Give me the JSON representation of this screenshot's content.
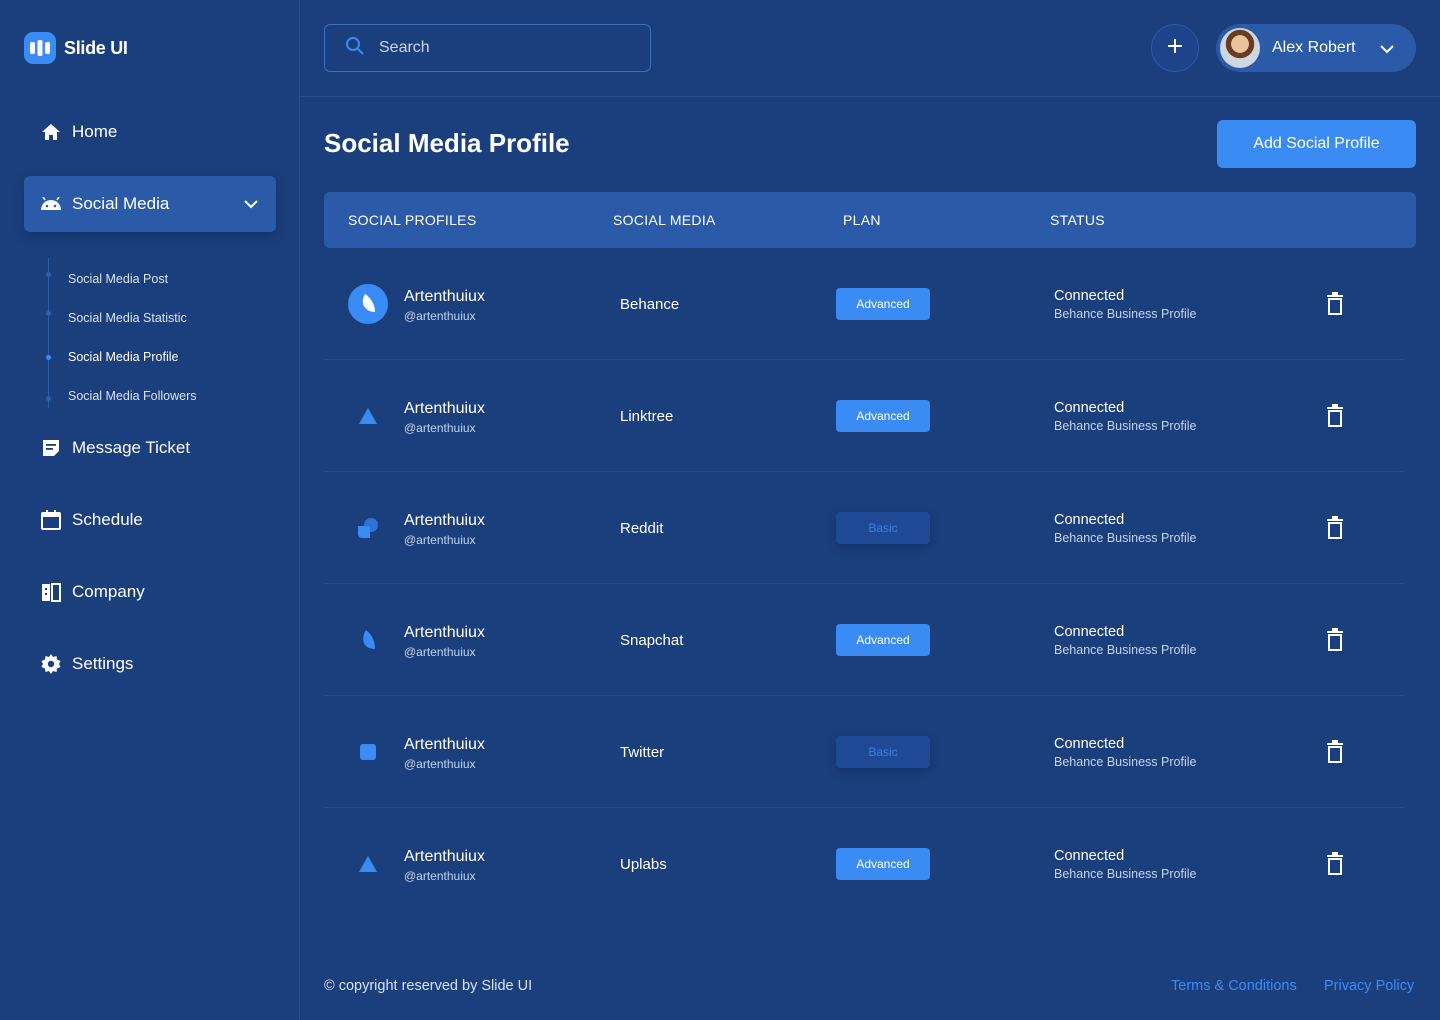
{
  "app": {
    "name": "Slide UI"
  },
  "colors": {
    "background": "#1b3f7c",
    "accent": "#3b8bf5",
    "active_item": "#2a5aa8"
  },
  "sidebar": {
    "items": [
      {
        "label": "Home",
        "icon": "home-icon"
      },
      {
        "label": "Social Media",
        "icon": "android-icon",
        "expanded": true
      },
      {
        "label": "Message Ticket",
        "icon": "ticket-icon"
      },
      {
        "label": "Schedule",
        "icon": "calendar-icon"
      },
      {
        "label": "Company",
        "icon": "company-icon"
      },
      {
        "label": "Settings",
        "icon": "gear-icon"
      }
    ],
    "submenu": [
      {
        "label": "Social Media Post"
      },
      {
        "label": "Social Media Statistic"
      },
      {
        "label": "Social Media Profile",
        "active": true
      },
      {
        "label": "Social Media Followers"
      }
    ]
  },
  "header": {
    "search_placeholder": "Search",
    "user_name": "Alex Robert"
  },
  "main": {
    "title": "Social Media Profile",
    "add_button": "Add Social Profile",
    "columns": [
      "SOCIAL PROFILES",
      "SOCIAL MEDIA",
      "PLAN",
      "STATUS"
    ],
    "rows": [
      {
        "name": "Artenthuiux",
        "handle": "@artenthuiux",
        "media": "Behance",
        "plan": "Advanced",
        "status": "Connected",
        "status_detail": "Behance Business Profile",
        "icon": "leaf-circle-icon"
      },
      {
        "name": "Artenthuiux",
        "handle": "@artenthuiux",
        "media": "Linktree",
        "plan": "Advanced",
        "status": "Connected",
        "status_detail": "Behance Business Profile",
        "icon": "triangle-icon"
      },
      {
        "name": "Artenthuiux",
        "handle": "@artenthuiux",
        "media": "Reddit",
        "plan": "Basic",
        "status": "Connected",
        "status_detail": "Behance Business Profile",
        "icon": "blob-icon"
      },
      {
        "name": "Artenthuiux",
        "handle": "@artenthuiux",
        "media": "Snapchat",
        "plan": "Advanced",
        "status": "Connected",
        "status_detail": "Behance Business Profile",
        "icon": "leaf-icon"
      },
      {
        "name": "Artenthuiux",
        "handle": "@artenthuiux",
        "media": "Twitter",
        "plan": "Basic",
        "status": "Connected",
        "status_detail": "Behance Business Profile",
        "icon": "square-icon"
      },
      {
        "name": "Artenthuiux",
        "handle": "@artenthuiux",
        "media": "Uplabs",
        "plan": "Advanced",
        "status": "Connected",
        "status_detail": "Behance Business Profile",
        "icon": "triangle-icon"
      }
    ]
  },
  "footer": {
    "copyright": "© copyright reserved by Slide UI",
    "terms": "Terms & Conditions",
    "privacy": "Privacy Policy"
  }
}
